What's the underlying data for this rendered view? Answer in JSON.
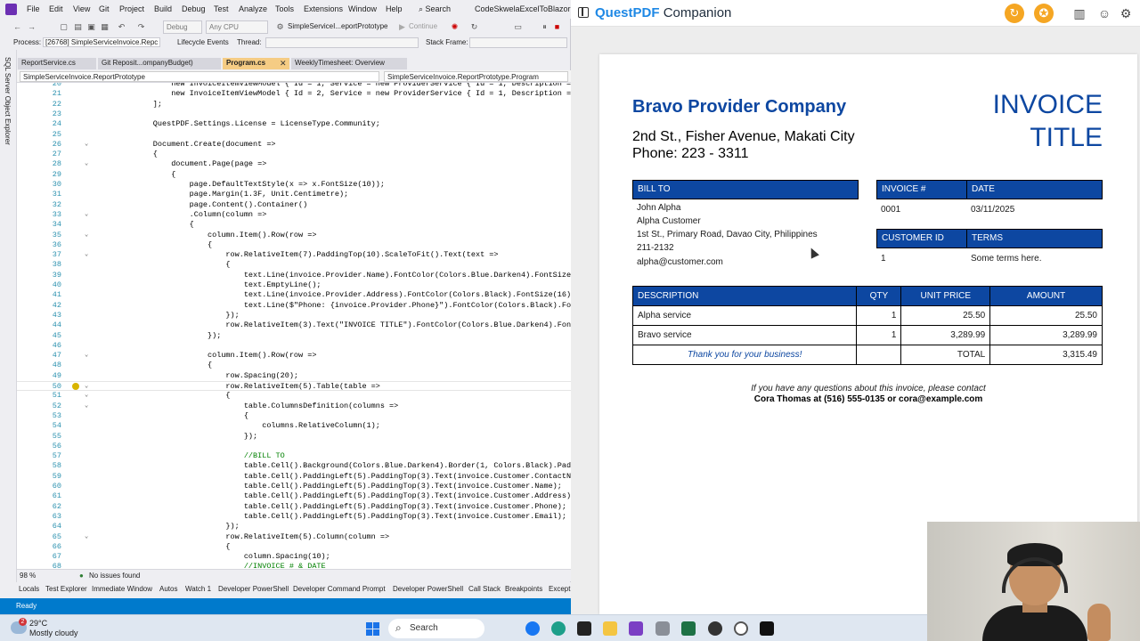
{
  "vs": {
    "menu": [
      "File",
      "Edit",
      "View",
      "Git",
      "Project",
      "Build",
      "Debug",
      "Test",
      "Analyze",
      "Tools",
      "Extensions",
      "Window",
      "Help"
    ],
    "search_label": "Search",
    "solution_name": "CodeSkwelaExcelToBlazor",
    "toolbar": {
      "config": "Debug",
      "platform": "Any CPU",
      "startup_project": "SimpleServiceI...eportPrototype",
      "continue_label": "Continue"
    },
    "debug_bar": {
      "process_label": "Process:",
      "process_value": "[26768] SimpleServiceInvoice.Repc",
      "lifecycle_label": "Lifecycle Events",
      "thread_label": "Thread:",
      "stack_frame_label": "Stack Frame:"
    },
    "left_rail_label": "SQL Server Object Explorer",
    "tabs": [
      "ReportService.cs",
      "Git Reposit...ompanyBudget)",
      "Program.cs",
      "WeeklyTimesheet: Overview"
    ],
    "nav_left": "SimpleServiceInvoice.ReportPrototype",
    "nav_right": "SimpleServiceInvoice.ReportPrototype.Program",
    "zoom": "98 %",
    "issues": "No issues found",
    "bottom_tabs": [
      "Locals",
      "Test Explorer",
      "Immediate Window",
      "Autos",
      "Watch 1",
      "Developer PowerShell",
      "Developer Command Prompt",
      "Developer PowerShell",
      "Call Stack",
      "Breakpoints",
      "Except"
    ],
    "status": "Ready",
    "code_lines": [
      {
        "n": "20",
        "t": "            new InvoiceItemViewModel { Id = 1, Service = new ProviderService { Id = 1, Description ="
      },
      {
        "n": "21",
        "t": "            new InvoiceItemViewModel { Id = 2, Service = new ProviderService { Id = 1, Description = \""
      },
      {
        "n": "22",
        "t": "        ];"
      },
      {
        "n": "23",
        "t": ""
      },
      {
        "n": "24",
        "t": "        QuestPDF.Settings.License = LicenseType.Community;"
      },
      {
        "n": "25",
        "t": ""
      },
      {
        "n": "26",
        "t": "        Document.Create(document =>"
      },
      {
        "n": "27",
        "t": "        {"
      },
      {
        "n": "28",
        "t": "            document.Page(page =>"
      },
      {
        "n": "29",
        "t": "            {"
      },
      {
        "n": "30",
        "t": "                page.DefaultTextStyle(x => x.FontSize(10));"
      },
      {
        "n": "31",
        "t": "                page.Margin(1.3F, Unit.Centimetre);"
      },
      {
        "n": "32",
        "t": "                page.Content().Container()"
      },
      {
        "n": "33",
        "t": "                .Column(column =>"
      },
      {
        "n": "34",
        "t": "                {"
      },
      {
        "n": "35",
        "t": "                    column.Item().Row(row =>"
      },
      {
        "n": "36",
        "t": "                    {"
      },
      {
        "n": "37",
        "t": "                        row.RelativeItem(7).PaddingTop(10).ScaleToFit().Text(text =>"
      },
      {
        "n": "38",
        "t": "                        {"
      },
      {
        "n": "39",
        "t": "                            text.Line(invoice.Provider.Name).FontColor(Colors.Blue.Darken4).FontSize(2"
      },
      {
        "n": "40",
        "t": "                            text.EmptyLine();"
      },
      {
        "n": "41",
        "t": "                            text.Line(invoice.Provider.Address).FontColor(Colors.Black).FontSize(16);"
      },
      {
        "n": "42",
        "t": "                            text.Line($\"Phone: {invoice.Provider.Phone}\").FontColor(Colors.Black).Font"
      },
      {
        "n": "43",
        "t": "                        });"
      },
      {
        "n": "44",
        "t": "                        row.RelativeItem(3).Text(\"INVOICE TITLE\").FontColor(Colors.Blue.Darken4).FontS"
      },
      {
        "n": "45",
        "t": "                    });"
      },
      {
        "n": "46",
        "t": ""
      },
      {
        "n": "47",
        "t": "                    column.Item().Row(row =>"
      },
      {
        "n": "48",
        "t": "                    {"
      },
      {
        "n": "49",
        "t": "                        row.Spacing(20);"
      },
      {
        "n": "50",
        "t": "                        row.RelativeItem(5).Table(table =>"
      },
      {
        "n": "51",
        "t": "                        {"
      },
      {
        "n": "52",
        "t": "                            table.ColumnsDefinition(columns =>"
      },
      {
        "n": "53",
        "t": "                            {"
      },
      {
        "n": "54",
        "t": "                                columns.RelativeColumn(1);"
      },
      {
        "n": "55",
        "t": "                            });"
      },
      {
        "n": "56",
        "t": ""
      },
      {
        "n": "57",
        "t": "                            //BILL TO"
      },
      {
        "n": "58",
        "t": "                            table.Cell().Background(Colors.Blue.Darken4).Border(1, Colors.Black).Paddi"
      },
      {
        "n": "59",
        "t": "                            table.Cell().PaddingLeft(5).PaddingTop(3).Text(invoice.Customer.ContactNam"
      },
      {
        "n": "60",
        "t": "                            table.Cell().PaddingLeft(5).PaddingTop(3).Text(invoice.Customer.Name);"
      },
      {
        "n": "61",
        "t": "                            table.Cell().PaddingLeft(5).PaddingTop(3).Text(invoice.Customer.Address);"
      },
      {
        "n": "62",
        "t": "                            table.Cell().PaddingLeft(5).PaddingTop(3).Text(invoice.Customer.Phone);"
      },
      {
        "n": "63",
        "t": "                            table.Cell().PaddingLeft(5).PaddingTop(3).Text(invoice.Customer.Email);"
      },
      {
        "n": "64",
        "t": "                        });"
      },
      {
        "n": "65",
        "t": "                        row.RelativeItem(5).Column(column =>"
      },
      {
        "n": "66",
        "t": "                        {"
      },
      {
        "n": "67",
        "t": "                            column.Spacing(10);"
      },
      {
        "n": "68",
        "t": "                            //INVOICE # & DATE"
      },
      {
        "n": "69",
        "t": "                            column.Item().Table(table =>"
      }
    ]
  },
  "companion": {
    "brand_bold": "QuestPDF",
    "brand_rest": "Companion",
    "invoice": {
      "provider_name": "Bravo Provider Company",
      "provider_address": "2nd St., Fisher Avenue, Makati City",
      "provider_phone": "Phone: 223 - 3311",
      "title_line1": "INVOICE",
      "title_line2": "TITLE",
      "bill_to_header": "BILL TO",
      "customer": {
        "contact_name": "John Alpha",
        "name": "Alpha Customer",
        "address": "1st St., Primary Road, Davao City, Philippines",
        "phone": "211-2132",
        "email": "alpha@customer.com"
      },
      "invoice_no_header": "INVOICE #",
      "date_header": "DATE",
      "invoice_no": "0001",
      "date": "03/11/2025",
      "customer_id_header": "CUSTOMER ID",
      "terms_header": "TERMS",
      "customer_id": "1",
      "terms": "Some terms here.",
      "columns": [
        "DESCRIPTION",
        "QTY",
        "UNIT PRICE",
        "AMOUNT"
      ],
      "items": [
        {
          "description": "Alpha service",
          "qty": "1",
          "unit_price": "25.50",
          "amount": "25.50"
        },
        {
          "description": "Bravo service",
          "qty": "1",
          "unit_price": "3,289.99",
          "amount": "3,289.99"
        }
      ],
      "thanks": "Thank you for your business!",
      "total_label": "TOTAL",
      "total": "3,315.49",
      "contact_note": "If you have any questions about this invoice, please contact",
      "contact_info": "Cora Thomas at (516) 555-0135 or cora@example.com"
    }
  },
  "taskbar": {
    "weather_temp": "29°C",
    "weather_desc": "Mostly cloudy",
    "notification_count": "2",
    "search_label": "Search"
  }
}
